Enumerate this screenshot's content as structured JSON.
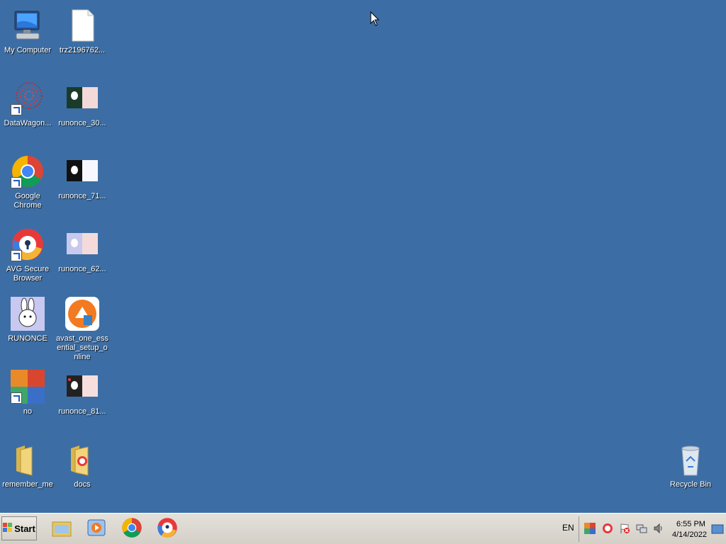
{
  "desktop": {
    "icons": [
      {
        "label": "My Computer"
      },
      {
        "label": "trz2196762..."
      },
      {
        "label": "DataWagon..."
      },
      {
        "label": "runonce_30..."
      },
      {
        "label": "Google Chrome"
      },
      {
        "label": "runonce_71..."
      },
      {
        "label": "AVG Secure Browser"
      },
      {
        "label": "runonce_62..."
      },
      {
        "label": "RUNONCE"
      },
      {
        "label": "avast_one_essential_setup_online"
      },
      {
        "label": "no"
      },
      {
        "label": "runonce_81..."
      },
      {
        "label": "remember_me"
      },
      {
        "label": "docs"
      },
      {
        "label": "Recycle Bin"
      }
    ]
  },
  "taskbar": {
    "start_label": "Start",
    "language": "EN",
    "time": "6:55 PM",
    "date": "4/14/2022"
  },
  "colors": {
    "desktop_bg": "#3c6ea5",
    "taskbar_bg": "#d4d0c8"
  }
}
